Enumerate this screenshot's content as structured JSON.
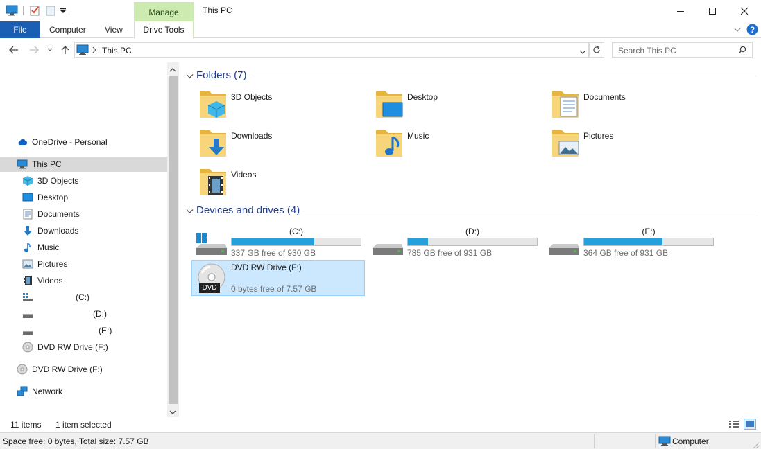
{
  "titlebar": {
    "title": "This PC",
    "context_tab": "Manage",
    "icons": [
      "computer-icon",
      "properties-icon",
      "new-folder-icon",
      "customize-qat-icon"
    ]
  },
  "ribbon": {
    "tabs": [
      {
        "label": "File"
      },
      {
        "label": "Computer"
      },
      {
        "label": "View"
      },
      {
        "label": "Drive Tools"
      }
    ]
  },
  "address": {
    "path": "This PC",
    "search_placeholder": "Search This PC"
  },
  "navpane": {
    "items": [
      {
        "label": "OneDrive - Personal",
        "icon": "cloud-icon"
      },
      {
        "label": "This PC",
        "icon": "computer-icon",
        "selected": true
      },
      {
        "label": "3D Objects",
        "icon": "cube-icon"
      },
      {
        "label": "Desktop",
        "icon": "desktop-icon"
      },
      {
        "label": "Documents",
        "icon": "document-icon"
      },
      {
        "label": "Downloads",
        "icon": "download-arrow-icon"
      },
      {
        "label": "Music",
        "icon": "music-note-icon"
      },
      {
        "label": "Pictures",
        "icon": "picture-icon"
      },
      {
        "label": "Videos",
        "icon": "film-icon"
      },
      {
        "label": "(C:)",
        "icon": "windows-drive-icon"
      },
      {
        "label": "(D:)",
        "icon": "drive-icon"
      },
      {
        "label": "(E:)",
        "icon": "drive-icon"
      },
      {
        "label": "DVD RW Drive (F:)",
        "icon": "disc-icon"
      },
      {
        "label": "DVD RW Drive (F:)",
        "icon": "disc-icon"
      },
      {
        "label": "Network",
        "icon": "network-icon"
      }
    ]
  },
  "folders": {
    "header": "Folders (7)",
    "items": [
      {
        "label": "3D Objects",
        "icon": "cube-icon"
      },
      {
        "label": "Desktop",
        "icon": "desktop-icon"
      },
      {
        "label": "Documents",
        "icon": "document-icon"
      },
      {
        "label": "Downloads",
        "icon": "download-arrow-icon"
      },
      {
        "label": "Music",
        "icon": "music-note-icon"
      },
      {
        "label": "Pictures",
        "icon": "picture-icon"
      },
      {
        "label": "Videos",
        "icon": "film-icon"
      }
    ]
  },
  "drives": {
    "header": "Devices and drives (4)",
    "items": [
      {
        "name": "(C:)",
        "free": "337 GB free of 930 GB",
        "used_fraction": 0.638
      },
      {
        "name": "(D:)",
        "free": "785 GB free of 931 GB",
        "used_fraction": 0.157
      },
      {
        "name": "(E:)",
        "free": "364 GB free of 931 GB",
        "used_fraction": 0.609
      },
      {
        "name": "DVD RW Drive (F:)",
        "free": "0 bytes free of 7.57 GB",
        "badge": "DVD",
        "selected": true
      }
    ]
  },
  "status": {
    "items": "11 items",
    "selected": "1 item selected",
    "space": "Space free: 0 bytes, Total size: 7.57 GB",
    "location": "Computer"
  },
  "colors": {
    "accent": "#1a5fb4",
    "context_tab": "#cdeab0",
    "capacity_bar": "#26a0da",
    "selection": "#cce8ff",
    "group_title": "#1e3d8f"
  }
}
